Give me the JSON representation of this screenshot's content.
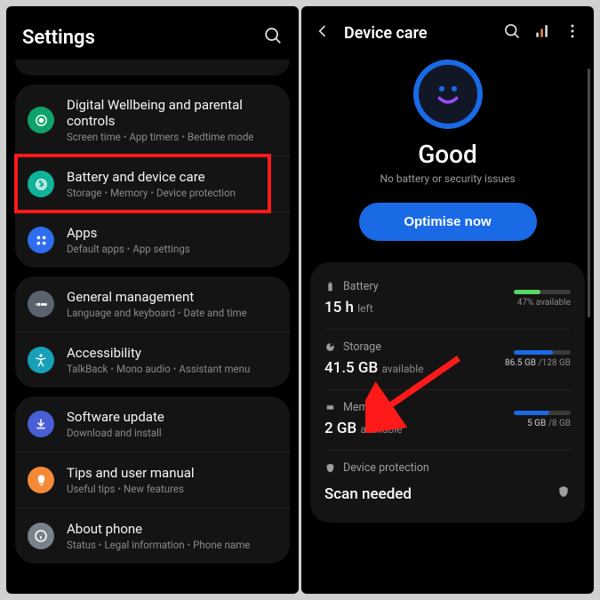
{
  "left": {
    "header": {
      "title": "Settings"
    },
    "groups": [
      {
        "rows": [
          {
            "icon": "wellbeing",
            "color": "#0fa36b",
            "title": "Digital Wellbeing and parental controls",
            "sub": [
              "Screen time",
              "App timers",
              "Bedtime mode"
            ],
            "interactable": true
          },
          {
            "icon": "device-care",
            "color": "#10b29a",
            "title": "Battery and device care",
            "sub": [
              "Storage",
              "Memory",
              "Device protection"
            ],
            "interactable": true,
            "highlighted": true
          },
          {
            "icon": "apps",
            "color": "#2e6cf0",
            "title": "Apps",
            "sub": [
              "Default apps",
              "App settings"
            ],
            "interactable": true
          }
        ]
      },
      {
        "rows": [
          {
            "icon": "general",
            "color": "#5a636d",
            "title": "General management",
            "sub": [
              "Language and keyboard",
              "Date and time"
            ],
            "interactable": true
          },
          {
            "icon": "accessibility",
            "color": "#18a0b8",
            "title": "Accessibility",
            "sub": [
              "TalkBack",
              "Mono audio",
              "Assistant menu"
            ],
            "interactable": true
          }
        ]
      },
      {
        "rows": [
          {
            "icon": "update",
            "color": "#4a5fd4",
            "title": "Software update",
            "sub": [
              "Download and install"
            ],
            "interactable": true
          },
          {
            "icon": "tips",
            "color": "#f48a36",
            "title": "Tips and user manual",
            "sub": [
              "Useful tips",
              "New features"
            ],
            "interactable": true
          },
          {
            "icon": "about",
            "color": "#7a828a",
            "title": "About phone",
            "sub": [
              "Status",
              "Legal information",
              "Phone name"
            ],
            "interactable": true
          }
        ]
      }
    ]
  },
  "right": {
    "header": {
      "title": "Device care"
    },
    "hero": {
      "status": "Good",
      "sub": "No battery or security issues",
      "button": "Optimise now"
    },
    "stats": {
      "battery": {
        "label": "Battery",
        "value": "15 h",
        "value_sub": "left",
        "right_sub": "47% available",
        "fill": 0.47,
        "color": "#58d964"
      },
      "storage": {
        "label": "Storage",
        "value": "41.5 GB",
        "value_sub": "available",
        "right_sub_used": "86.5 GB",
        "right_sub_total": "/128 GB",
        "fill": 0.68,
        "color": "#1a6ae6"
      },
      "memory": {
        "label": "Memory",
        "value": "2 GB",
        "value_sub": "available",
        "right_sub_used": "5 GB",
        "right_sub_total": "/8 GB",
        "fill": 0.63,
        "color": "#1a6ae6"
      },
      "protection": {
        "label": "Device protection",
        "value": "Scan needed"
      }
    }
  }
}
